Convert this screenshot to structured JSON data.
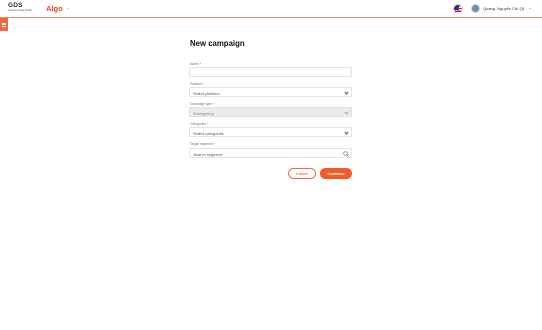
{
  "header": {
    "logo_main": "GDS",
    "logo_sub": "Growing Data Studio",
    "app_name": "Algo",
    "user_name": "Quang. Nguyễn Chí (3)"
  },
  "page": {
    "title": "New campaign"
  },
  "form": {
    "name": {
      "label": "Name *",
      "value": ""
    },
    "platform": {
      "label": "Platform *",
      "placeholder": "Select platform"
    },
    "campaign_type": {
      "label": "Campaign type *",
      "value": "Retargeting"
    },
    "categories": {
      "label": "Categories *",
      "placeholder": "Select categories"
    },
    "target_segment": {
      "label": "Target segment *",
      "placeholder": "Search segment"
    }
  },
  "actions": {
    "cancel_label": "Cancel",
    "continue_label": "Continue"
  },
  "colors": {
    "accent": "#f25a28",
    "brand_dark": "#1f2a44"
  },
  "icons": {
    "menu": "hamburger-icon",
    "flag": "us-flag-icon",
    "search": "search-icon",
    "dropdown": "chevron-down-icon"
  }
}
